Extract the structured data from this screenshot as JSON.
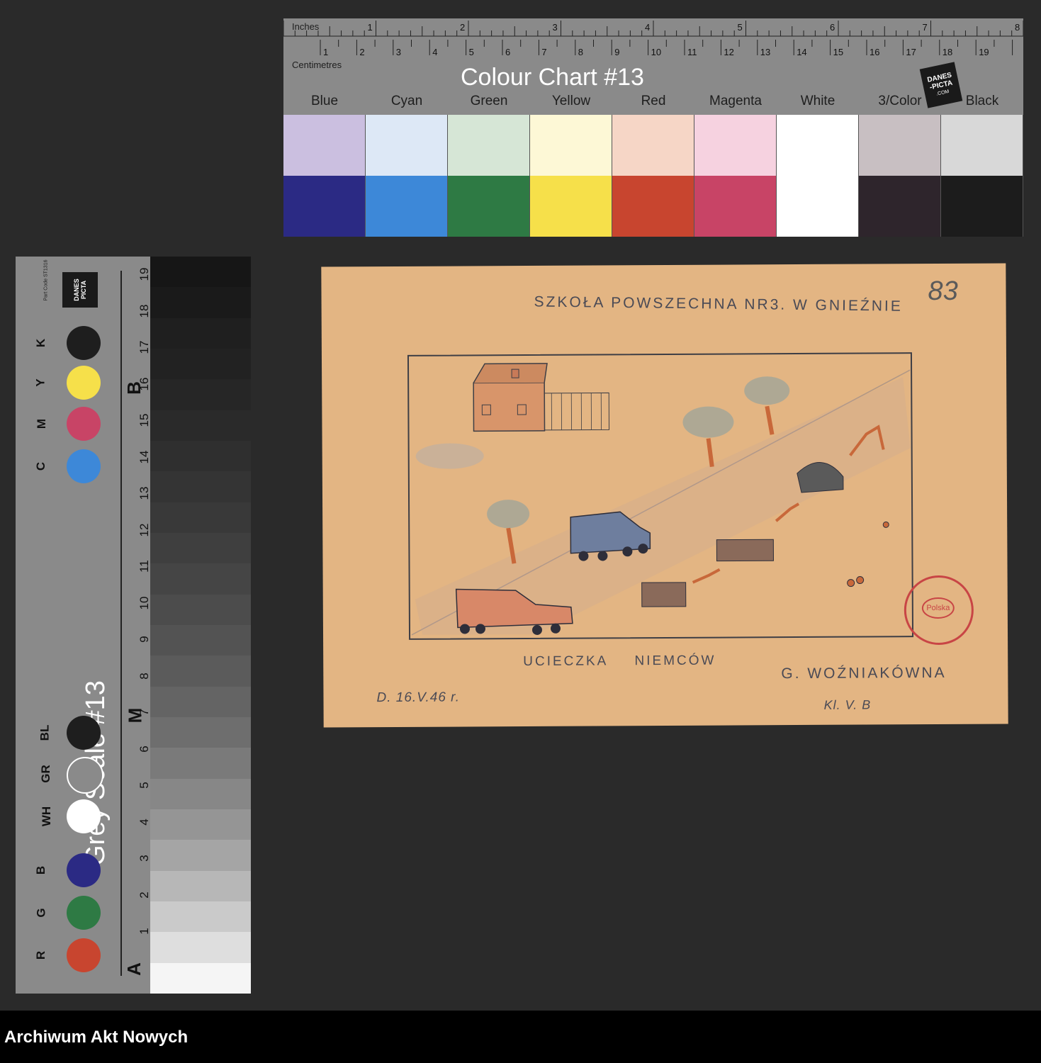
{
  "colour_chart": {
    "inches_label": "Inches",
    "cm_label": "Centimetres",
    "title": "Colour Chart #13",
    "logo_lines": [
      "DANES",
      "-PICTA",
      ".COM"
    ],
    "inch_numbers": [
      "1",
      "2",
      "3",
      "4",
      "5",
      "6",
      "7",
      "8"
    ],
    "cm_numbers": [
      "1",
      "2",
      "3",
      "4",
      "5",
      "6",
      "7",
      "8",
      "9",
      "10",
      "11",
      "12",
      "13",
      "14",
      "15",
      "16",
      "17",
      "18",
      "19"
    ],
    "patches": [
      {
        "name": "Blue",
        "light": "#cbbfe0",
        "dark": "#2b2a84"
      },
      {
        "name": "Cyan",
        "light": "#dde8f6",
        "dark": "#3d88d8"
      },
      {
        "name": "Green",
        "light": "#d6e6d6",
        "dark": "#2e7a44"
      },
      {
        "name": "Yellow",
        "light": "#fdf8d6",
        "dark": "#f6e04a"
      },
      {
        "name": "Red",
        "light": "#f6d6c6",
        "dark": "#c8452f"
      },
      {
        "name": "Magenta",
        "light": "#f6d2e0",
        "dark": "#c84466"
      },
      {
        "name": "White",
        "light": "#ffffff",
        "dark": "#ffffff"
      },
      {
        "name": "3/Color",
        "light": "#c8bfc2",
        "dark": "#2e252c"
      },
      {
        "name": "Black",
        "light": "#d8d8d8",
        "dark": "#1c1c1c"
      }
    ]
  },
  "grey_scale": {
    "title": "Grey Scale #13",
    "part_code": "Part Code ST1316",
    "logo": "DANES PICTA",
    "dots": [
      {
        "label": "R",
        "color": "#c8452f"
      },
      {
        "label": "G",
        "color": "#2e7a44"
      },
      {
        "label": "B",
        "color": "#2b2a84"
      },
      {
        "label": "WH",
        "color": "#ffffff"
      },
      {
        "label": "GR",
        "color": "#8a8a8a"
      },
      {
        "label": "BL",
        "color": "#1e1e1e"
      },
      {
        "label": "C",
        "color": "#3d88d8"
      },
      {
        "label": "M",
        "color": "#c84466"
      },
      {
        "label": "Y",
        "color": "#f6e04a"
      },
      {
        "label": "K",
        "color": "#1e1e1e"
      }
    ],
    "step_numbers": [
      "1",
      "2",
      "3",
      "4",
      "5",
      "6",
      "7",
      "8",
      "9",
      "10",
      "11",
      "12",
      "13",
      "14",
      "15",
      "16",
      "17",
      "18",
      "19"
    ],
    "markers": [
      "A",
      "M",
      "B"
    ],
    "step_colors": [
      "#161616",
      "#1a1a1a",
      "#1f1f1f",
      "#222222",
      "#262626",
      "#2a2a2a",
      "#2f2f2f",
      "#343434",
      "#393939",
      "#3f3f3f",
      "#454545",
      "#4c4c4c",
      "#535353",
      "#5b5b5b",
      "#646464",
      "#6e6e6e",
      "#7a7a7a",
      "#878787",
      "#959595",
      "#a5a5a5",
      "#b7b7b7",
      "#cacaca",
      "#dedede",
      "#f5f5f5"
    ]
  },
  "drawing": {
    "school": "SZKOŁA POWSZECHNA NR3. W GNIEŹNIE",
    "number": "83",
    "caption": "UCIECZKA NIEMCÓW",
    "author": "G. WOŹNIAKÓWNA",
    "date": "D. 16.V.46 r.",
    "class": "Kl. V. B",
    "stamp_text": "Polska"
  },
  "footer": {
    "label": "Archiwum Akt Nowych"
  }
}
